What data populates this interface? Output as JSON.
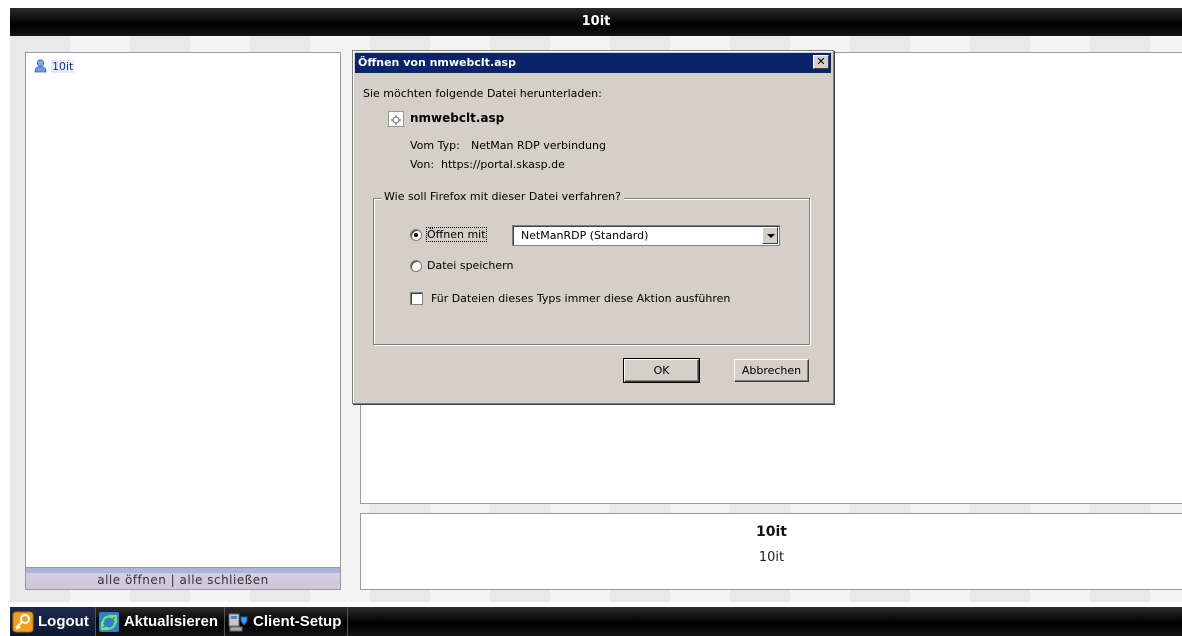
{
  "window": {
    "title": "10it"
  },
  "tree": {
    "items": [
      {
        "label": "10it",
        "icon": "user-icon"
      }
    ],
    "footer": {
      "open_all": "alle öffnen",
      "separator": " | ",
      "close_all": "alle schließen"
    }
  },
  "info": {
    "title": "10it",
    "subtitle": "10it"
  },
  "toolbar": {
    "logout": "Logout",
    "refresh": "Aktualisieren",
    "client_setup": "Client-Setup"
  },
  "dialog": {
    "title": "Öffnen von nmwebclt.asp",
    "close": "✕",
    "prompt": "Sie möchten folgende Datei herunterladen:",
    "file_name": "nmwebclt.asp",
    "type_label": "Vom Typ:",
    "type_value": "NetMan RDP verbindung",
    "from_label": "Von:",
    "from_value": "https://portal.skasp.de",
    "group_legend": "Wie soll Firefox mit dieser Datei verfahren?",
    "open_with_label": "Öffnen mit",
    "open_with_value": "NetManRDP (Standard)",
    "save_file_label": "Datei speichern",
    "always_label": "Für Dateien dieses Typs immer diese Aktion ausführen",
    "ok_label": "OK",
    "cancel_label": "Abbrechen"
  },
  "colors": {
    "title_bar": "#000000",
    "dialog_title": "#0a246a",
    "dialog_face": "#d4d0c8",
    "tree_label": "#1a3a8a"
  }
}
